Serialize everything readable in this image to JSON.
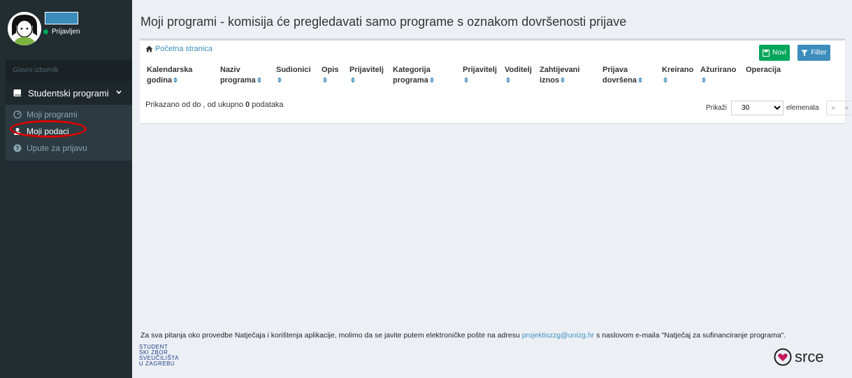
{
  "user": {
    "status": "Prijavljen"
  },
  "sidebar": {
    "header": "Glavni izbornik",
    "section": "Studentski programi",
    "items": [
      {
        "label": "Moji programi",
        "icon": "dashboard-icon"
      },
      {
        "label": "Moji podaci",
        "icon": "user-icon"
      },
      {
        "label": "Upute za prijavu",
        "icon": "question-circle-icon"
      }
    ]
  },
  "main": {
    "title": "Moji programi - komisija će pregledavati samo programe s oznakom dovršenosti prijave",
    "breadcrumb": "Početna stranica",
    "buttons": {
      "new": "Novi",
      "filter": "Filter"
    },
    "columns": [
      [
        "Kalendarska",
        "godina"
      ],
      [
        "Naziv",
        "programa"
      ],
      [
        "Sudionici",
        ""
      ],
      [
        "Opis",
        ""
      ],
      [
        "Prijavitelj",
        ""
      ],
      [
        "Kategorija",
        "programa"
      ],
      [
        "Prijavitelj",
        ""
      ],
      [
        "Voditelj",
        ""
      ],
      [
        "Zahtijevani",
        "iznos"
      ],
      [
        "Prijava",
        "dovršena"
      ],
      [
        "Kreirano",
        ""
      ],
      [
        "Ažurirano",
        ""
      ],
      [
        "Operacija",
        ""
      ]
    ],
    "info_prefix": "Prikazano od do , od ukupno ",
    "info_count": "0",
    "info_suffix": " podataka",
    "pager": {
      "show": "Prikaži",
      "page_size": "30",
      "elements": "elemenata",
      "prev": "«",
      "next": "»"
    }
  },
  "footer": {
    "text_before": "Za sva pitanja oko provedbe Natječaja i korištenja aplikacije, molimo da se javite putem elektroničke pošte na adresu ",
    "email": "projektiszzg@unizg.hr",
    "text_after": " s naslovom e-maila \"Natječaj za sufinanciranje programa\".",
    "logo_left_lines": [
      "STUDENT",
      "SKI ZBOR",
      "SVEUČILIŠTA",
      "U ZAGREBU"
    ],
    "logo_right": "srce"
  },
  "colors": {
    "sidebar": "#222d32",
    "accent": "#3c8dbc",
    "success": "#00a65a",
    "highlight": "#dd0000"
  }
}
